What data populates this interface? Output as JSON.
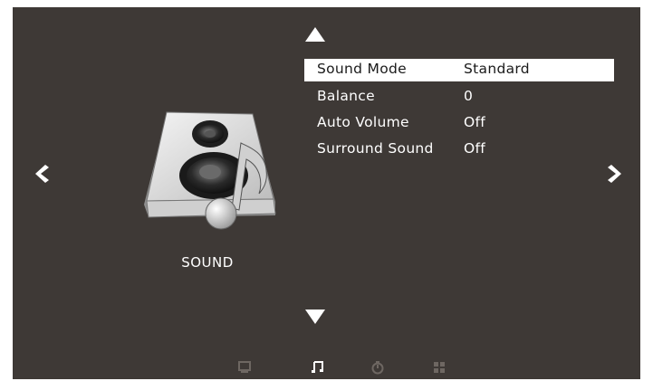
{
  "section_title": "SOUND",
  "menu": {
    "items": [
      {
        "label": "Sound Mode",
        "value": "Standard",
        "selected": true
      },
      {
        "label": "Balance",
        "value": "0",
        "selected": false
      },
      {
        "label": "Auto Volume",
        "value": "Off",
        "selected": false
      },
      {
        "label": "Surround Sound",
        "value": "Off",
        "selected": false
      }
    ]
  },
  "icons": {
    "up": "triangle-up-icon",
    "down": "triangle-down-icon",
    "left": "chevron-left-icon",
    "right": "chevron-right-icon",
    "section": "speaker-music-note-icon",
    "bottom_nav": [
      "picture-icon",
      "sound-icon",
      "timer-icon",
      "settings-icon"
    ]
  },
  "colors": {
    "background": "#3e3936",
    "text": "#ffffff",
    "selected_bg": "#ffffff",
    "selected_text": "#1a1a1a",
    "inactive_icon": "#6e6762",
    "active_icon": "#ffffff"
  }
}
